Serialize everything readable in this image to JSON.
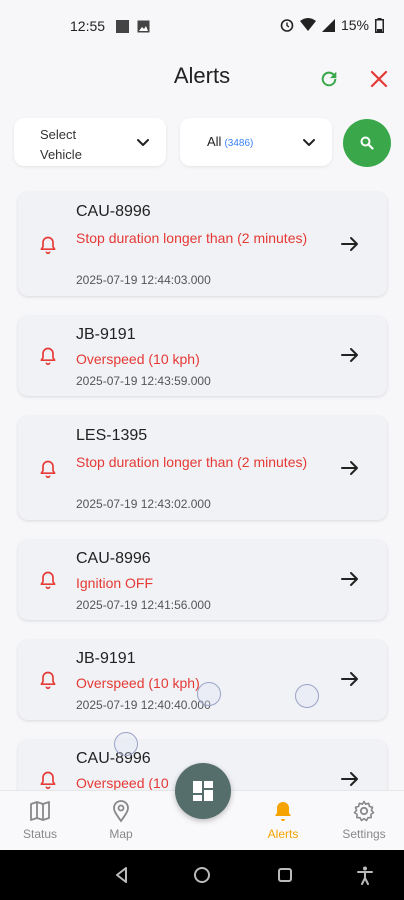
{
  "status_bar": {
    "time": "12:55",
    "battery": "15%"
  },
  "header": {
    "title": "Alerts",
    "icons": [
      "refresh-icon",
      "close-icon"
    ],
    "colors": {
      "refresh": "#3aa84a",
      "close": "#e53935"
    }
  },
  "filters": {
    "vehicle_label": "Select Vehicle",
    "type_label": "All",
    "type_count": "(3486)"
  },
  "alerts": [
    {
      "plate": "CAU-8996",
      "message": "Stop duration longer than (2 minutes)",
      "timestamp": "2025-07-19 12:44:03.000"
    },
    {
      "plate": "JB-9191",
      "message": "Overspeed (10 kph)",
      "timestamp": "2025-07-19 12:43:59.000"
    },
    {
      "plate": "LES-1395",
      "message": "Stop duration longer than (2 minutes)",
      "timestamp": "2025-07-19 12:43:02.000"
    },
    {
      "plate": "CAU-8996",
      "message": "Ignition OFF",
      "timestamp": "2025-07-19 12:41:56.000"
    },
    {
      "plate": "JB-9191",
      "message": "Overspeed (10 kph)",
      "timestamp": "2025-07-19 12:40:40.000"
    },
    {
      "plate": "CAU-8996",
      "message": "Overspeed (10",
      "timestamp": ""
    }
  ],
  "bottom_nav": {
    "items": [
      {
        "label": "Status",
        "icon": "map-icon"
      },
      {
        "label": "Map",
        "icon": "location-pin-icon"
      },
      {
        "label": "Alerts",
        "icon": "bell-icon"
      },
      {
        "label": "Settings",
        "icon": "gear-icon"
      }
    ],
    "active": "Alerts",
    "active_color": "#f5a300"
  },
  "fab": {
    "icon": "dashboard-icon"
  },
  "colors": {
    "alert_red": "#e53935",
    "accent_green": "#3aa84a",
    "count_blue": "#3b82f6"
  }
}
